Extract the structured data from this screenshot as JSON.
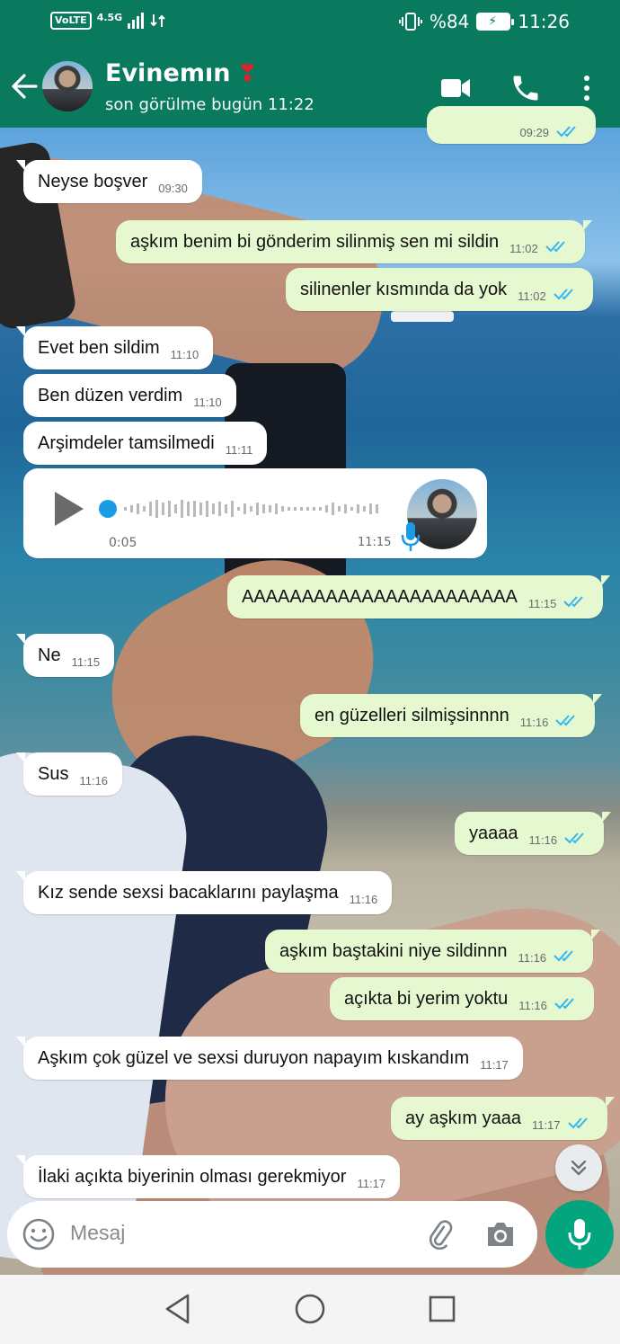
{
  "status_bar": {
    "volte": "VoLTE",
    "network": "4.5G",
    "battery_percent": "%84",
    "time": "11:26"
  },
  "header": {
    "contact_name": "Evinemın",
    "heart_emoji": "❣",
    "last_seen": "son görülme bugün 11:22"
  },
  "messages": [
    {
      "dir": "out",
      "text": "",
      "time": "09:29",
      "partial": true
    },
    {
      "dir": "in",
      "text": "Neyse boşver",
      "time": "09:30"
    },
    {
      "dir": "out",
      "text": "aşkım benim bi gönderim silinmiş sen mi sildin",
      "time": "11:02"
    },
    {
      "dir": "out",
      "text": "silinenler kısmında da yok",
      "time": "11:02"
    },
    {
      "dir": "in",
      "text": "Evet ben sildim",
      "time": "11:10"
    },
    {
      "dir": "in",
      "text": "Ben düzen verdim",
      "time": "11:10"
    },
    {
      "dir": "in",
      "text": "Arşimdeler tamsilmedi",
      "time": "11:11"
    },
    {
      "dir": "out",
      "text": "AAAAAAAAAAAAAAAAAAAAAAA",
      "time": "11:15"
    },
    {
      "dir": "in",
      "text": "Ne",
      "time": "11:15"
    },
    {
      "dir": "out",
      "text": "en güzelleri silmişsinnnn",
      "time": "11:16"
    },
    {
      "dir": "in",
      "text": "Sus",
      "time": "11:16"
    },
    {
      "dir": "out",
      "text": "yaaaa",
      "time": "11:16"
    },
    {
      "dir": "in",
      "text": "Kız sende sexsi bacaklarını paylaşma",
      "time": "11:16"
    },
    {
      "dir": "out",
      "text": "aşkım baştakini niye sildinnn",
      "time": "11:16"
    },
    {
      "dir": "out",
      "text": "açıkta bi yerim yoktu",
      "time": "11:16"
    },
    {
      "dir": "in",
      "text": "Aşkım çok güzel ve sexsi duruyon napayım kıskandım",
      "time": "11:17"
    },
    {
      "dir": "out",
      "text": "ay aşkım yaaa",
      "time": "11:17"
    },
    {
      "dir": "in",
      "text": "İlaki açıkta biyerinin olması gerekmiyor",
      "time": "11:17"
    }
  ],
  "voice_message": {
    "duration": "0:05",
    "time": "11:15"
  },
  "input": {
    "placeholder": "Mesaj"
  },
  "colors": {
    "header": "#0a7a5e",
    "accent": "#03a57f",
    "outgoing_bubble": "#e6f8cf",
    "read_ticks": "#34b7f1"
  },
  "icons": {
    "header": [
      "back-arrow-icon",
      "video-call-icon",
      "phone-icon",
      "more-vert-icon"
    ],
    "input": [
      "emoji-icon",
      "attach-icon",
      "camera-icon",
      "mic-icon"
    ],
    "nav": [
      "back-triangle-icon",
      "home-circle-icon",
      "recents-square-icon"
    ]
  }
}
